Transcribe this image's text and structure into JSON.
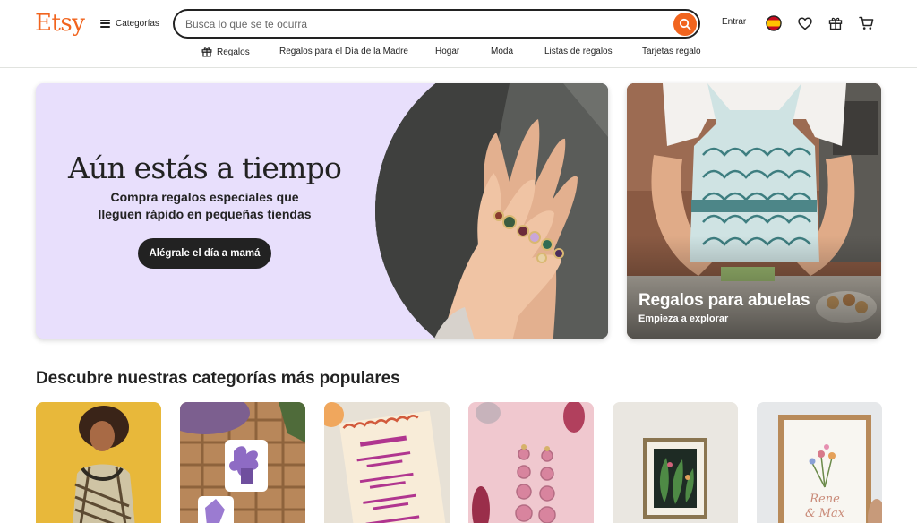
{
  "brand": {
    "logo_text": "Etsy",
    "accent_color": "#f1641e"
  },
  "header": {
    "categories_label": "Categorías",
    "search_placeholder": "Busca lo que se te ocurra",
    "signin_label": "Entrar",
    "icons": [
      "search-icon",
      "flag-icon",
      "heart-icon",
      "gift-icon",
      "cart-icon"
    ]
  },
  "subnav": {
    "items": [
      {
        "label": "Regalos",
        "icon": "gift-icon"
      },
      {
        "label": "Regalos para el Día de la Madre"
      },
      {
        "label": "Hogar"
      },
      {
        "label": "Moda"
      },
      {
        "label": "Listas de regalos"
      },
      {
        "label": "Tarjetas regalo"
      }
    ]
  },
  "hero": {
    "title": "Aún estás a tiempo",
    "subtitle_line1": "Compra regalos especiales que",
    "subtitle_line2": "lleguen rápido en pequeñas tiendas",
    "cta_label": "Alégrale el día a mamá",
    "background_color": "#e8dffc"
  },
  "promo": {
    "title": "Regalos para abuelas",
    "subtitle": "Empieza a explorar"
  },
  "categories": {
    "title": "Descubre nuestras categorías más populares",
    "cards": [
      "category-card-fashion",
      "category-card-stickers",
      "category-card-stationery",
      "category-card-jewelry",
      "category-card-art",
      "category-card-frames"
    ]
  }
}
